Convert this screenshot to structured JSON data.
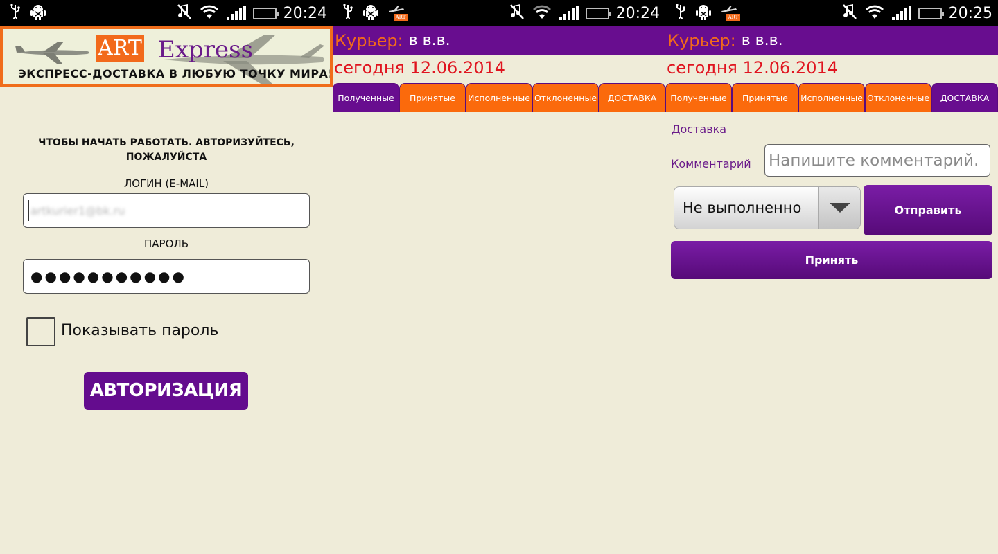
{
  "status_bar": {
    "screen1_time": "20:24",
    "screen2_time": "20:24",
    "screen3_time": "20:25",
    "notification_art": "ART"
  },
  "login": {
    "banner_art": "ART",
    "banner_express": "Express",
    "banner_slogan": "ЭКСПРЕСС-ДОСТАВКА В ЛЮБУЮ ТОЧКУ МИРА!",
    "title_line1": "ЧТОБЫ НАЧАТЬ РАБОТАТЬ. АВТОРИЗУЙТЕСЬ,",
    "title_line2": "ПОЖАЛУЙСТА",
    "login_label": "ЛОГИН (E-MAIL)",
    "login_value": "artkurier1@bk.ru",
    "password_label": "ПАРОЛЬ",
    "password_value": "●●●●●●●●●●●",
    "show_password_label": "Показывать пароль",
    "auth_button": "АВТОРИЗАЦИЯ"
  },
  "header": {
    "courier_label": "Курьер:",
    "courier_name": "в в.в.",
    "date_line": "сегодня 12.06.2014"
  },
  "tabs": [
    "Полученные",
    "Принятые",
    "Исполненные",
    "Отклоненные",
    "ДОСТАВКА"
  ],
  "delivery": {
    "title": "Доставка",
    "comment_label": "Комментарий",
    "comment_placeholder": "Напишите комментарий.",
    "status_value": "Не выполненно",
    "send_button": "Отправить",
    "accept_button": "Принять"
  },
  "colors": {
    "purple": "#680d8f",
    "orange": "#fb6a0c",
    "red_date": "#e0141f",
    "background": "#efecd9"
  }
}
